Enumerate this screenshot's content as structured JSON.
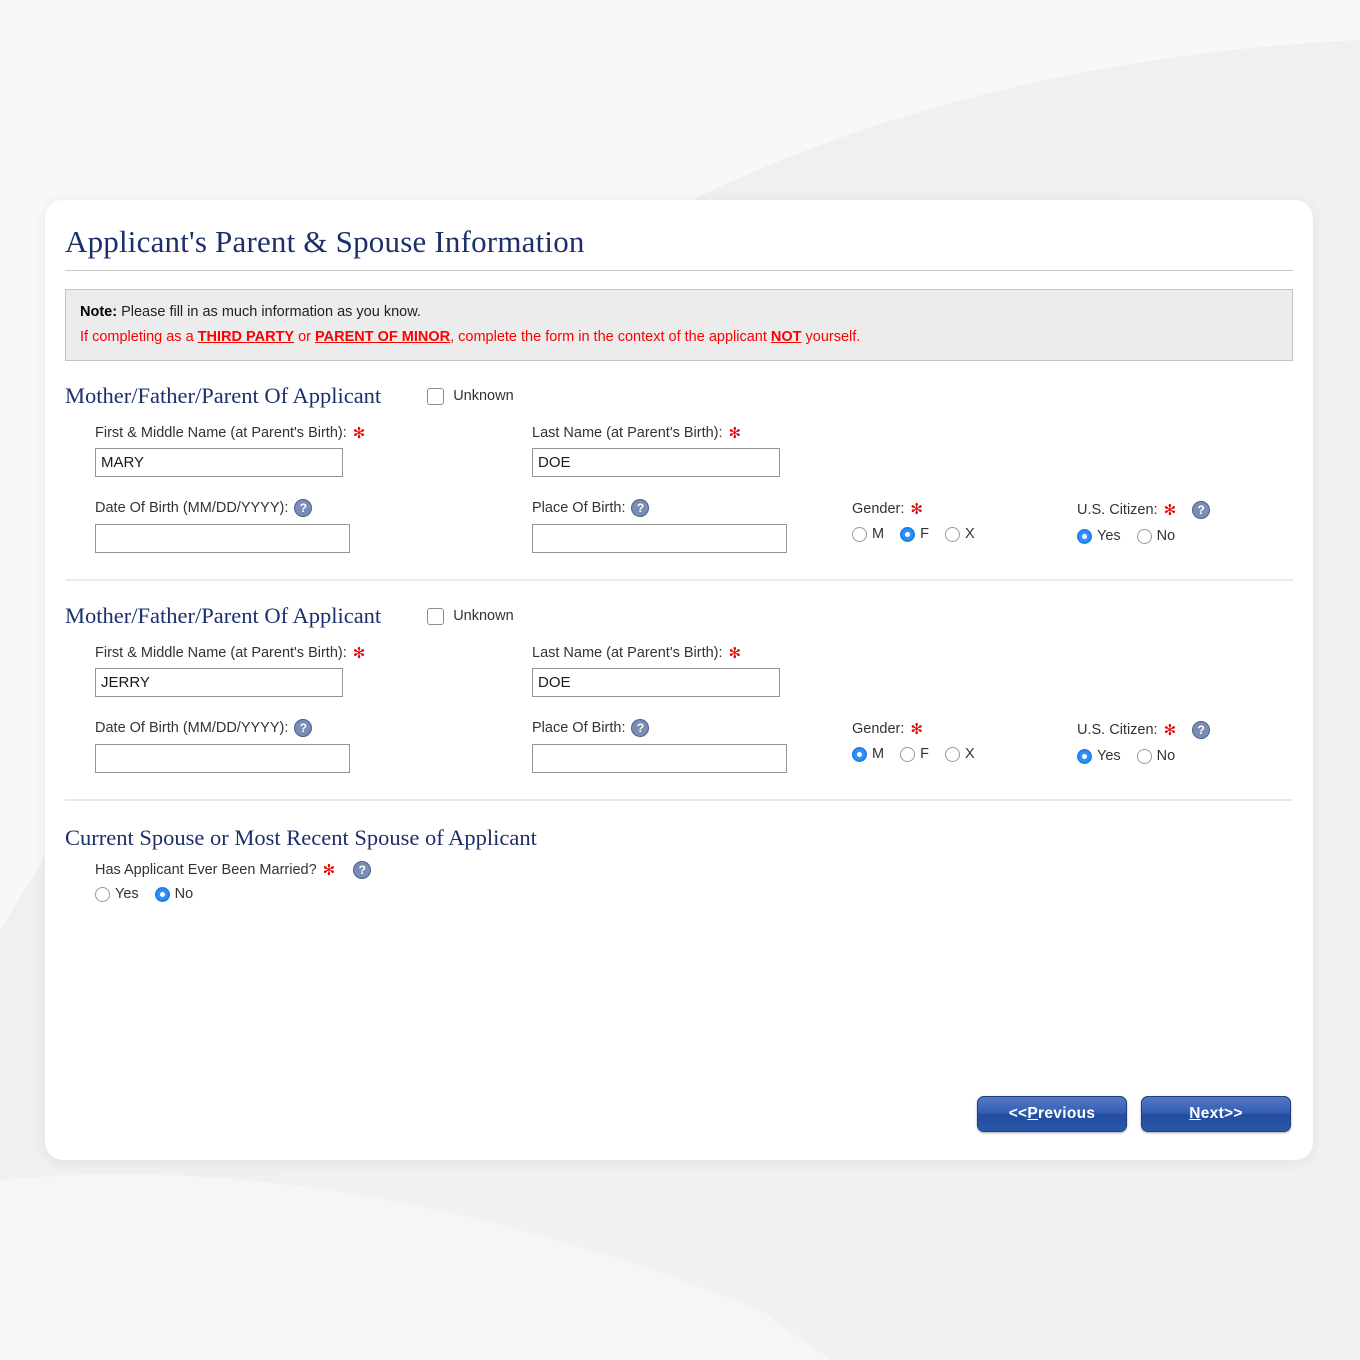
{
  "page": {
    "title": "Applicant's Parent & Spouse Information"
  },
  "note": {
    "label": "Note:",
    "line1_text": " Please fill in as much information as you know.",
    "line2_prefix": "If completing as a ",
    "line2_u1": "THIRD PARTY",
    "line2_mid": " or ",
    "line2_u2": "PARENT OF MINOR",
    "line2_mid2": ", complete the form in the context of the applicant ",
    "line2_u3": "NOT",
    "line2_suffix": " yourself.",
    "color": "#ff0000"
  },
  "parents": [
    {
      "section_title": "Mother/Father/Parent Of Applicant",
      "unknown_label": "Unknown",
      "unknown_checked": false,
      "first_name_label": "First & Middle Name (at Parent's Birth):",
      "first_name_value": "MARY",
      "last_name_label": "Last Name (at Parent's Birth):",
      "last_name_value": "DOE",
      "dob_label": "Date Of Birth (MM/DD/YYYY):",
      "dob_value": "",
      "pob_label": "Place Of Birth:",
      "pob_value": "",
      "gender_label": "Gender:",
      "gender_options": [
        "M",
        "F",
        "X"
      ],
      "gender_selected": "F",
      "citizen_label": "U.S. Citizen:",
      "citizen_options": [
        "Yes",
        "No"
      ],
      "citizen_selected": "Yes"
    },
    {
      "section_title": "Mother/Father/Parent Of Applicant",
      "unknown_label": "Unknown",
      "unknown_checked": false,
      "first_name_label": "First & Middle Name (at Parent's Birth):",
      "first_name_value": "JERRY",
      "last_name_label": "Last Name (at Parent's Birth):",
      "last_name_value": "DOE",
      "dob_label": "Date Of Birth (MM/DD/YYYY):",
      "dob_value": "",
      "pob_label": "Place Of Birth:",
      "pob_value": "",
      "gender_label": "Gender:",
      "gender_options": [
        "M",
        "F",
        "X"
      ],
      "gender_selected": "M",
      "citizen_label": "U.S. Citizen:",
      "citizen_options": [
        "Yes",
        "No"
      ],
      "citizen_selected": "Yes"
    }
  ],
  "spouse": {
    "section_title": "Current Spouse or Most Recent Spouse of Applicant",
    "question_label": "Has Applicant Ever Been Married?",
    "options": [
      "Yes",
      "No"
    ],
    "selected": "No"
  },
  "icons": {
    "help": "?",
    "required_star": "✻"
  },
  "buttons": {
    "previous_pre": "<< ",
    "previous_key": "P",
    "previous_rest": "revious",
    "next_key": "N",
    "next_rest": "ext",
    "next_post": " >>"
  },
  "colors": {
    "title": "#1c2f6b",
    "required": "#e60000",
    "note_red": "#ff0000",
    "radio_on": "#2f90f5",
    "button": "#2b57ab"
  }
}
